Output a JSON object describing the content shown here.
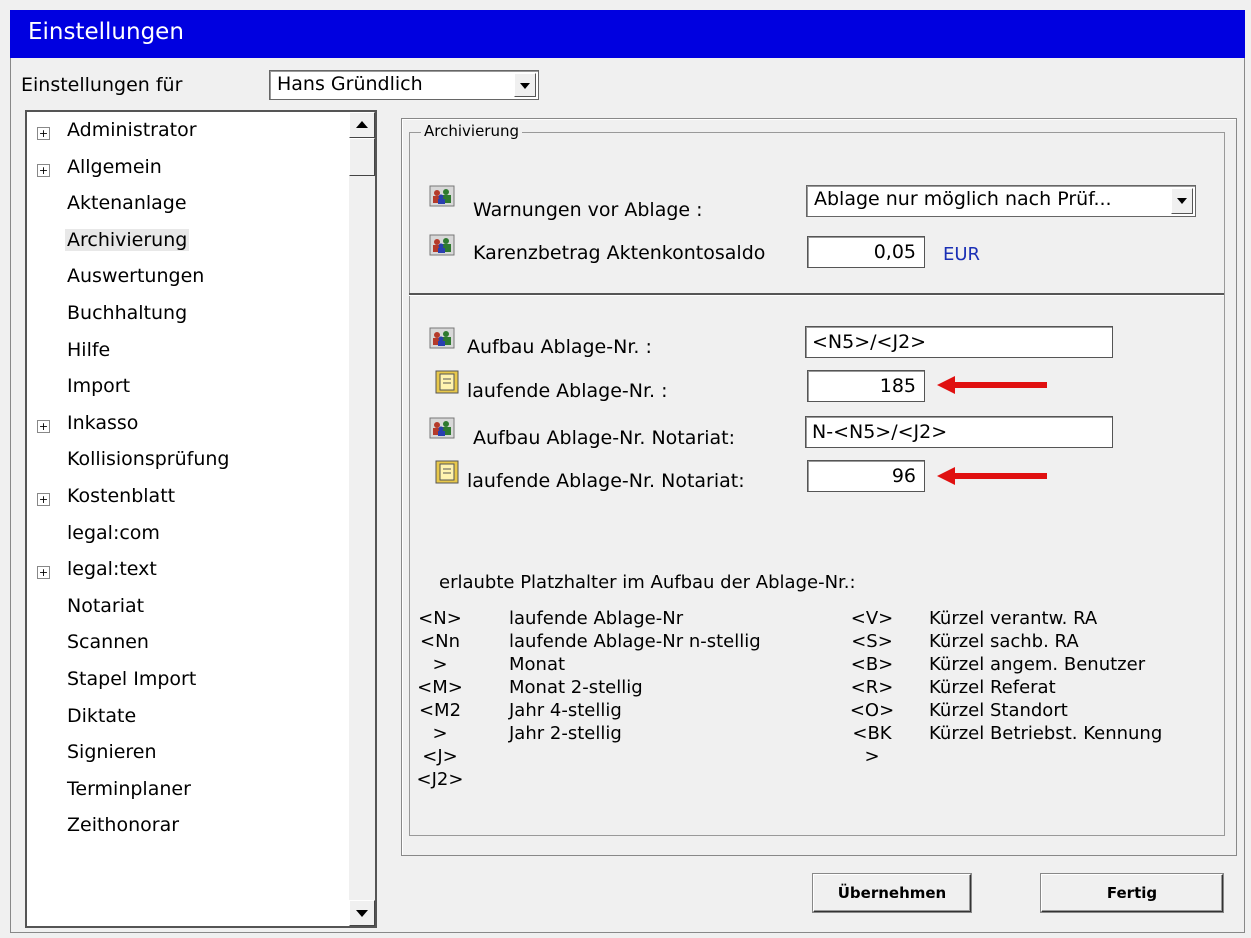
{
  "window": {
    "title": "Einstellungen"
  },
  "user_select": {
    "label": "Einstellungen für",
    "value": "Hans Gründlich"
  },
  "tree": {
    "items": [
      {
        "label": "Administrator",
        "expandable": true
      },
      {
        "label": "Allgemein",
        "expandable": true
      },
      {
        "label": "Aktenanlage",
        "expandable": false
      },
      {
        "label": "Archivierung",
        "expandable": false,
        "selected": true
      },
      {
        "label": "Auswertungen",
        "expandable": false
      },
      {
        "label": "Buchhaltung",
        "expandable": false
      },
      {
        "label": "Hilfe",
        "expandable": false
      },
      {
        "label": "Import",
        "expandable": false
      },
      {
        "label": "Inkasso",
        "expandable": true
      },
      {
        "label": "Kollisionsprüfung",
        "expandable": false
      },
      {
        "label": "Kostenblatt",
        "expandable": true
      },
      {
        "label": "legal:com",
        "expandable": false
      },
      {
        "label": "legal:text",
        "expandable": true
      },
      {
        "label": "Notariat",
        "expandable": false
      },
      {
        "label": "Scannen",
        "expandable": false
      },
      {
        "label": "Stapel Import",
        "expandable": false
      },
      {
        "label": "Diktate",
        "expandable": false
      },
      {
        "label": "Signieren",
        "expandable": false
      },
      {
        "label": "Terminplaner",
        "expandable": false
      },
      {
        "label": "Zeithonorar",
        "expandable": false
      }
    ],
    "expand_glyph": "+"
  },
  "archivierung": {
    "group_title": "Archivierung",
    "warnungen": {
      "label": "Warnungen vor Ablage :",
      "value": "Ablage nur möglich nach Prüf..."
    },
    "karenz": {
      "label": "Karenzbetrag Aktenkontosaldo",
      "value": "0,05",
      "unit": "EUR"
    },
    "aufbau": {
      "label": "Aufbau Ablage-Nr. :",
      "value": "<N5>/<J2>"
    },
    "laufende": {
      "label": "laufende Ablage-Nr. :",
      "value": "185"
    },
    "aufbau_notariat": {
      "label": "Aufbau Ablage-Nr. Notariat:",
      "value": "N-<N5>/<J2>"
    },
    "laufende_notariat": {
      "label": "laufende Ablage-Nr. Notariat:",
      "value": "96"
    },
    "placeholders_title": "erlaubte Platzhalter im Aufbau der Ablage-Nr.:",
    "placeholders_left_codes": [
      "<N>",
      "<Nn",
      ">",
      "<M>",
      "<M2",
      ">",
      "<J>",
      "<J2>"
    ],
    "placeholders_left_desc": [
      "laufende Ablage-Nr",
      "laufende Ablage-Nr n-stellig",
      "Monat",
      "Monat 2-stellig",
      "Jahr 4-stellig",
      "Jahr 2-stellig"
    ],
    "placeholders_right_codes": [
      "<V>",
      "<S>",
      "<B>",
      "<R>",
      "<O>",
      "<BK",
      ">"
    ],
    "placeholders_right_desc": [
      "Kürzel verantw. RA",
      "Kürzel sachb. RA",
      "Kürzel angem. Benutzer",
      "Kürzel Referat",
      "Kürzel Standort",
      "Kürzel Betriebst. Kennung"
    ]
  },
  "buttons": {
    "apply": "Übernehmen",
    "done": "Fertig"
  },
  "colors": {
    "titlebar": "#0000e0",
    "unit": "#1a2fb5",
    "arrow": "#e01010"
  },
  "icons": [
    "users-icon",
    "counter-icon",
    "scroll-up-arrow-icon",
    "scroll-down-arrow-icon",
    "dropdown-arrow-icon",
    "red-arrow-icon"
  ]
}
